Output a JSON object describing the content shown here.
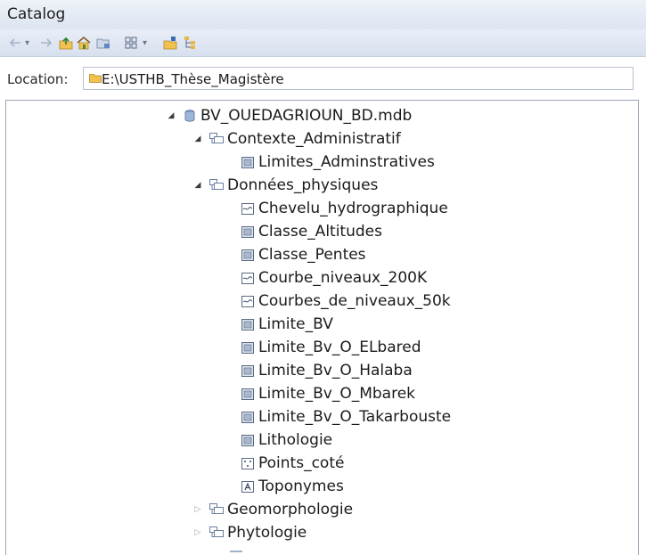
{
  "window": {
    "title": "Catalog"
  },
  "toolbar": {
    "buttons": [
      {
        "name": "back-button",
        "icon": "arrow-left-icon"
      },
      {
        "name": "back-dropdown",
        "icon": "chevron-down-icon"
      },
      {
        "name": "forward-button",
        "icon": "arrow-right-icon"
      },
      {
        "name": "up-one-level-button",
        "icon": "folder-up-icon"
      },
      {
        "name": "home-button",
        "icon": "home-icon"
      },
      {
        "name": "connect-folder-button",
        "icon": "connect-folder-icon"
      },
      {
        "name": "views-button",
        "icon": "grid-view-icon"
      },
      {
        "name": "views-dropdown",
        "icon": "chevron-down-icon"
      },
      {
        "name": "launch-arccatalog-button",
        "icon": "catalog-icon"
      },
      {
        "name": "toggle-contents-button",
        "icon": "tree-icon"
      }
    ]
  },
  "location": {
    "label": "Location:",
    "value": "E:\\USTHB_Thèse_Magistère",
    "icon": "folder-icon"
  },
  "tree": {
    "root": {
      "label": "BV_OUEDAGRIOUN_BD.mdb",
      "icon": "database-icon",
      "expanded": true
    },
    "datasets": [
      {
        "label": "Contexte_Administratif",
        "icon": "feature-dataset-icon",
        "expanded": true,
        "children": [
          {
            "label": "Limites_Adminstratives",
            "icon": "polygon-feature-class-icon"
          }
        ]
      },
      {
        "label": "Données_physiques",
        "icon": "feature-dataset-icon",
        "expanded": true,
        "children": [
          {
            "label": "Chevelu_hydrographique",
            "icon": "line-feature-class-icon"
          },
          {
            "label": "Classe_Altitudes",
            "icon": "polygon-feature-class-icon"
          },
          {
            "label": "Classe_Pentes",
            "icon": "polygon-feature-class-icon"
          },
          {
            "label": "Courbe_niveaux_200K",
            "icon": "line-feature-class-icon"
          },
          {
            "label": "Courbes_de_niveaux_50k",
            "icon": "line-feature-class-icon"
          },
          {
            "label": "Limite_BV",
            "icon": "polygon-feature-class-icon"
          },
          {
            "label": "Limite_Bv_O_ELbared",
            "icon": "polygon-feature-class-icon"
          },
          {
            "label": "Limite_Bv_O_Halaba",
            "icon": "polygon-feature-class-icon"
          },
          {
            "label": "Limite_Bv_O_Mbarek",
            "icon": "polygon-feature-class-icon"
          },
          {
            "label": "Limite_Bv_O_Takarbouste",
            "icon": "polygon-feature-class-icon"
          },
          {
            "label": "Lithologie",
            "icon": "polygon-feature-class-icon"
          },
          {
            "label": "Points_coté",
            "icon": "point-feature-class-icon"
          },
          {
            "label": "Toponymes",
            "icon": "annotation-feature-class-icon"
          }
        ]
      },
      {
        "label": "Geomorphologie",
        "icon": "feature-dataset-icon",
        "expanded": false,
        "children": []
      },
      {
        "label": "Phytologie",
        "icon": "feature-dataset-icon",
        "expanded": false,
        "children": []
      }
    ]
  },
  "colors": {
    "titlebar": "#e3e9f4",
    "toolbar_icon_dim": "#a7b4c7",
    "dataset_icon": "#6b7f9e",
    "feature_icon_fill": "#d9e1ec",
    "panel_border": "#9aa4b2"
  }
}
